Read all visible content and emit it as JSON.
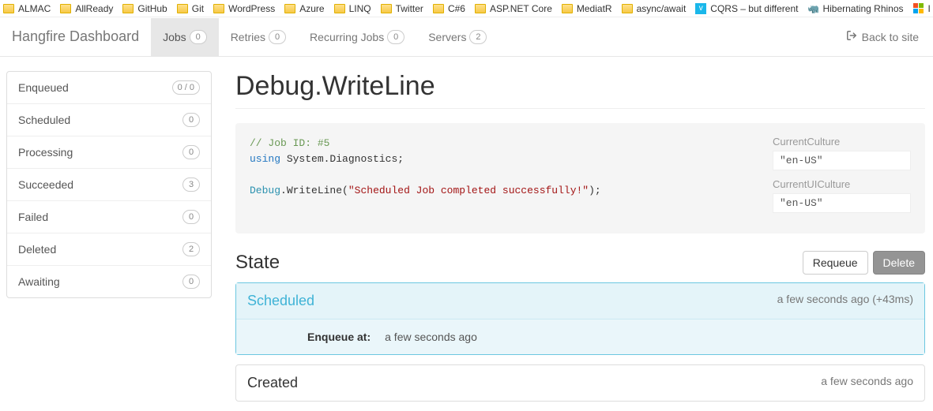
{
  "bookmarks": [
    {
      "type": "folder",
      "label": "ALMAC"
    },
    {
      "type": "folder",
      "label": "AllReady"
    },
    {
      "type": "folder",
      "label": "GitHub"
    },
    {
      "type": "folder",
      "label": "Git"
    },
    {
      "type": "folder",
      "label": "WordPress"
    },
    {
      "type": "folder",
      "label": "Azure"
    },
    {
      "type": "folder",
      "label": "LINQ"
    },
    {
      "type": "folder",
      "label": "Twitter"
    },
    {
      "type": "folder",
      "label": "C#6"
    },
    {
      "type": "folder",
      "label": "ASP.NET Core"
    },
    {
      "type": "folder",
      "label": "MediatR"
    },
    {
      "type": "folder",
      "label": "async/await"
    },
    {
      "type": "vimeo",
      "label": "CQRS – but different"
    },
    {
      "type": "rhino",
      "label": "Hibernating Rhinos"
    },
    {
      "type": "ms",
      "label": "I"
    }
  ],
  "navbar": {
    "brand": "Hangfire Dashboard",
    "tabs": [
      {
        "label": "Jobs",
        "count": "0",
        "active": true
      },
      {
        "label": "Retries",
        "count": "0"
      },
      {
        "label": "Recurring Jobs",
        "count": "0"
      },
      {
        "label": "Servers",
        "count": "2"
      }
    ],
    "back": "Back to site"
  },
  "sidebar": [
    {
      "label": "Enqueued",
      "count": "0 / 0"
    },
    {
      "label": "Scheduled",
      "count": "0"
    },
    {
      "label": "Processing",
      "count": "0"
    },
    {
      "label": "Succeeded",
      "count": "3"
    },
    {
      "label": "Failed",
      "count": "0"
    },
    {
      "label": "Deleted",
      "count": "2"
    },
    {
      "label": "Awaiting",
      "count": "0"
    }
  ],
  "job": {
    "title": "Debug.WriteLine",
    "code": {
      "comment": "// Job ID: #5",
      "using_kw": "using",
      "using_ns": "System.Diagnostics",
      "call_obj": "Debug",
      "call_method": "WriteLine",
      "arg_str": "\"Scheduled Job completed successfully!\""
    },
    "meta": {
      "culture_label": "CurrentCulture",
      "culture_value": "\"en-US\"",
      "uiculture_label": "CurrentUICulture",
      "uiculture_value": "\"en-US\""
    }
  },
  "state": {
    "heading": "State",
    "requeue": "Requeue",
    "delete": "Delete",
    "panels": [
      {
        "title": "Scheduled",
        "time": "a few seconds ago (+43ms)",
        "body_key": "Enqueue at:",
        "body_val": "a few seconds ago",
        "style": "scheduled"
      },
      {
        "title": "Created",
        "time": "a few seconds ago",
        "style": "plain"
      }
    ]
  }
}
